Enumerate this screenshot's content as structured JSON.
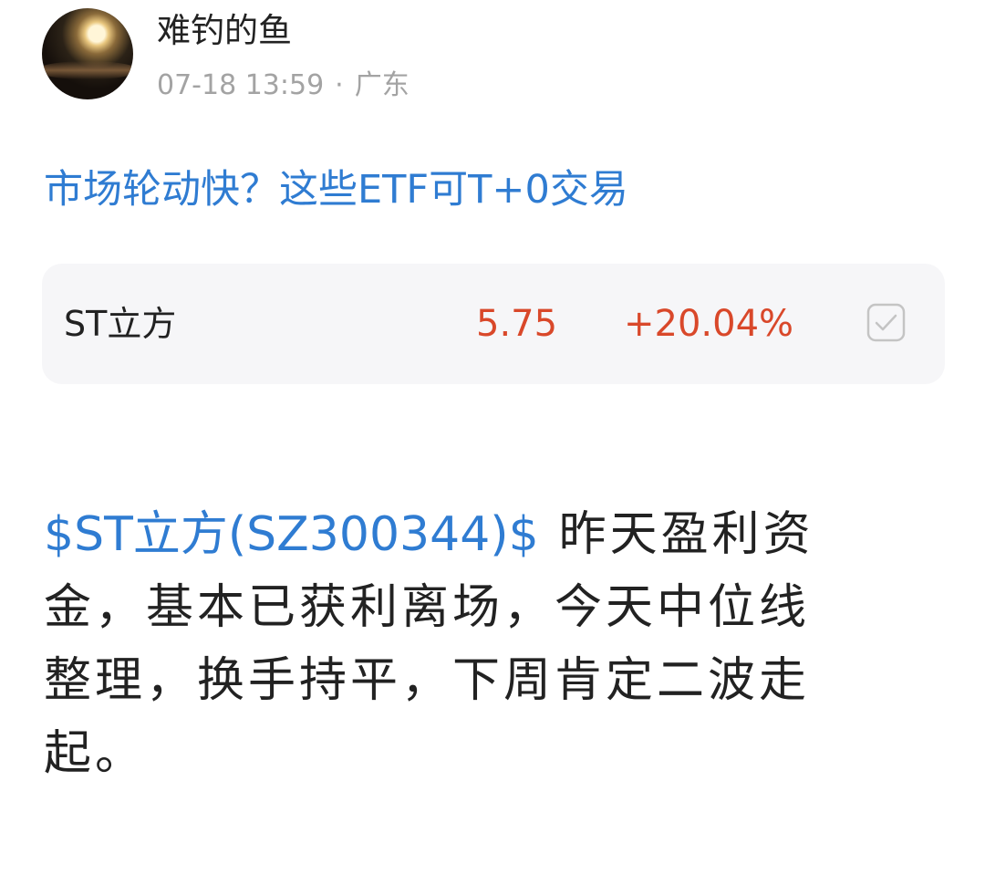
{
  "author": {
    "name": "难钓的鱼",
    "avatar_icon": "moon-avatar",
    "time": "07-18 13:59",
    "separator": "·",
    "location": "广东"
  },
  "promo": {
    "text": "市场轮动快？这些ETF可T+0交易",
    "color": "#2f7cd2"
  },
  "stock_card": {
    "name": "ST立方",
    "price": "5.75",
    "change": "+20.04%",
    "up_color": "#d9482a",
    "action_icon": "checkbox-icon"
  },
  "post": {
    "stock_tag": "$ST立方(SZ300344)$",
    "line1_rest": "昨天盈利资",
    "line2": "金，基本已获利离场，今天中位线",
    "line3": "整理，换手持平，下周肯定二波走",
    "line4": "起。"
  }
}
